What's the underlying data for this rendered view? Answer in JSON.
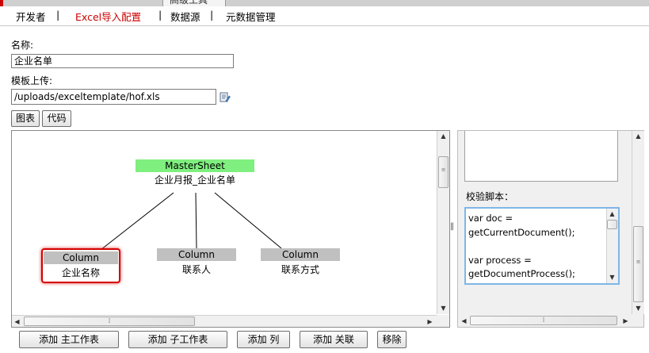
{
  "top_tab": {
    "label": "高级工具"
  },
  "nav": {
    "items": [
      {
        "label": "开发者",
        "active": false
      },
      {
        "label": "Excel导入配置",
        "active": true
      },
      {
        "label": "数据源",
        "active": false
      },
      {
        "label": "元数据管理",
        "active": false
      }
    ],
    "separator": "|"
  },
  "form": {
    "name_label": "名称:",
    "name_value": "企业名单",
    "template_label": "模板上传:",
    "template_value": "/uploads/exceltemplate/hof.xls"
  },
  "view_tabs": {
    "chart": "图表",
    "code": "代码"
  },
  "diagram": {
    "master": {
      "type": "MasterSheet",
      "name": "企业月报_企业名单"
    },
    "columns": [
      {
        "type": "Column",
        "name": "企业名称",
        "selected": true
      },
      {
        "type": "Column",
        "name": "联系人",
        "selected": false
      },
      {
        "type": "Column",
        "name": "联系方式",
        "selected": false
      }
    ]
  },
  "side": {
    "script_label": "校验脚本：",
    "script_lines": [
      "var doc =",
      "getCurrentDocument();",
      "",
      "var process =",
      "getDocumentProcess();"
    ]
  },
  "actions": {
    "add_main": "添加 主工作表",
    "add_sub": "添加 子工作表",
    "add_col": "添加 列",
    "add_rel": "添加 关联",
    "remove": "移除"
  },
  "colors": {
    "active_nav": "#cc0000",
    "master_head": "#7fef7f",
    "column_head": "#c0c0c0",
    "selected_border": "#d40000"
  }
}
